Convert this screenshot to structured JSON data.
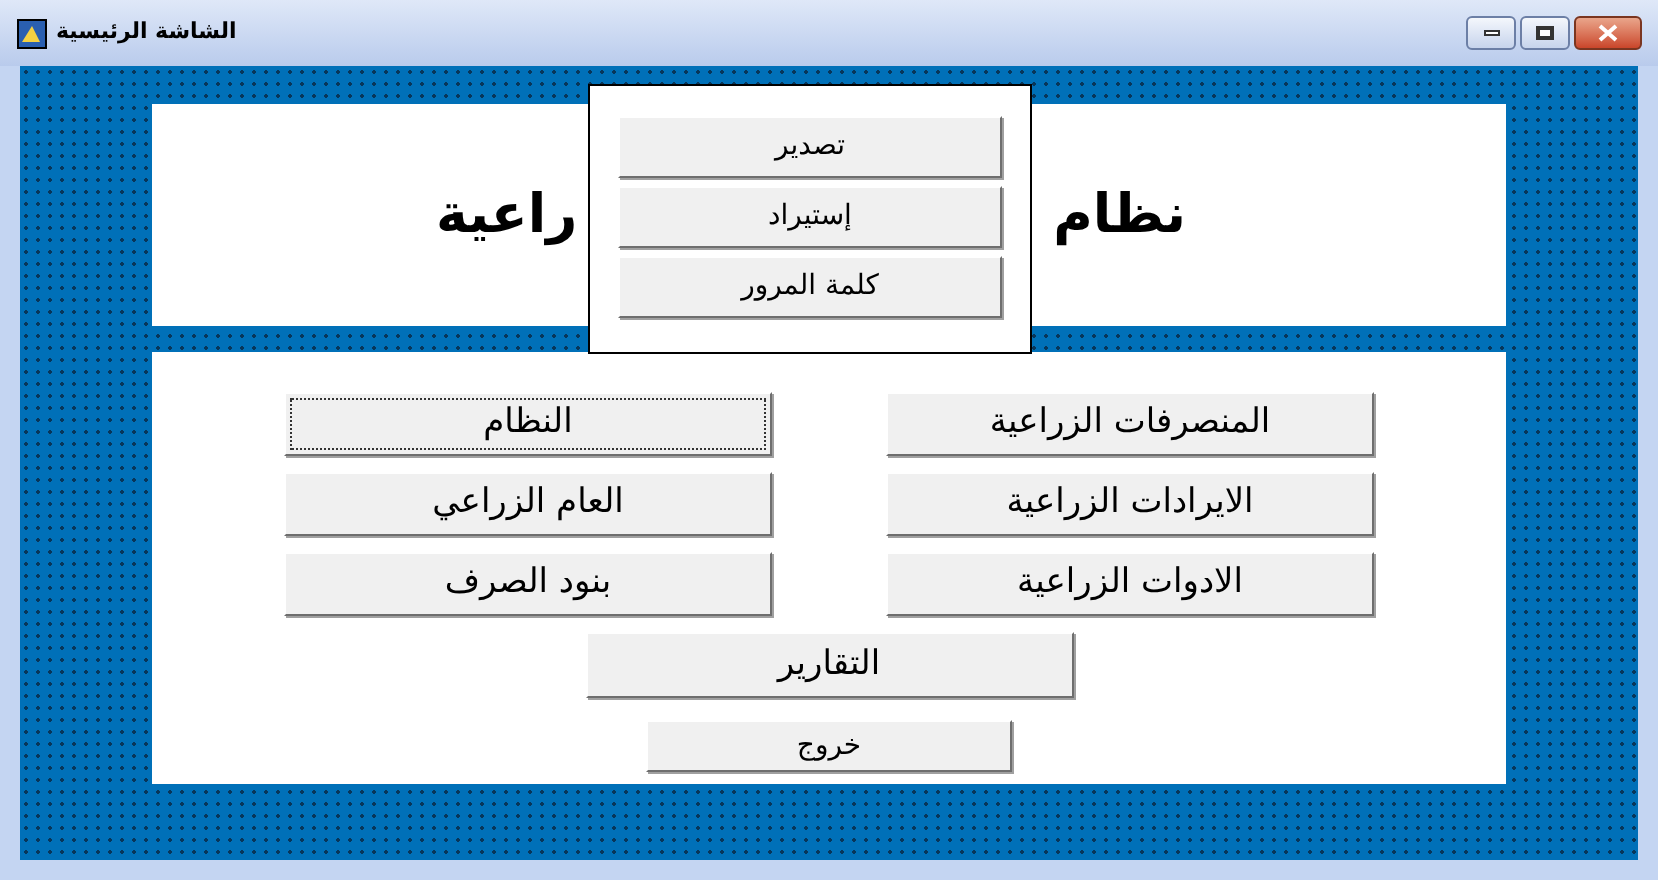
{
  "window": {
    "title": "الشاشة الرئيسية"
  },
  "header": {
    "title_right_visible": "نظام",
    "title_left_visible": "راعية"
  },
  "popup_menu": {
    "items": [
      "تصدير",
      "إستيراد",
      "كلمة المرور"
    ]
  },
  "buttons": [
    {
      "label": "المنصرفات الزراعية",
      "focused": false
    },
    {
      "label": "النظام",
      "focused": true
    },
    {
      "label": "الايرادات الزراعية",
      "focused": false
    },
    {
      "label": "العام الزراعي",
      "focused": false
    },
    {
      "label": "الادوات الزراعية",
      "focused": false
    },
    {
      "label": "بنود الصرف",
      "focused": false
    }
  ],
  "reports_button": "التقارير",
  "exit_button": "خروج"
}
